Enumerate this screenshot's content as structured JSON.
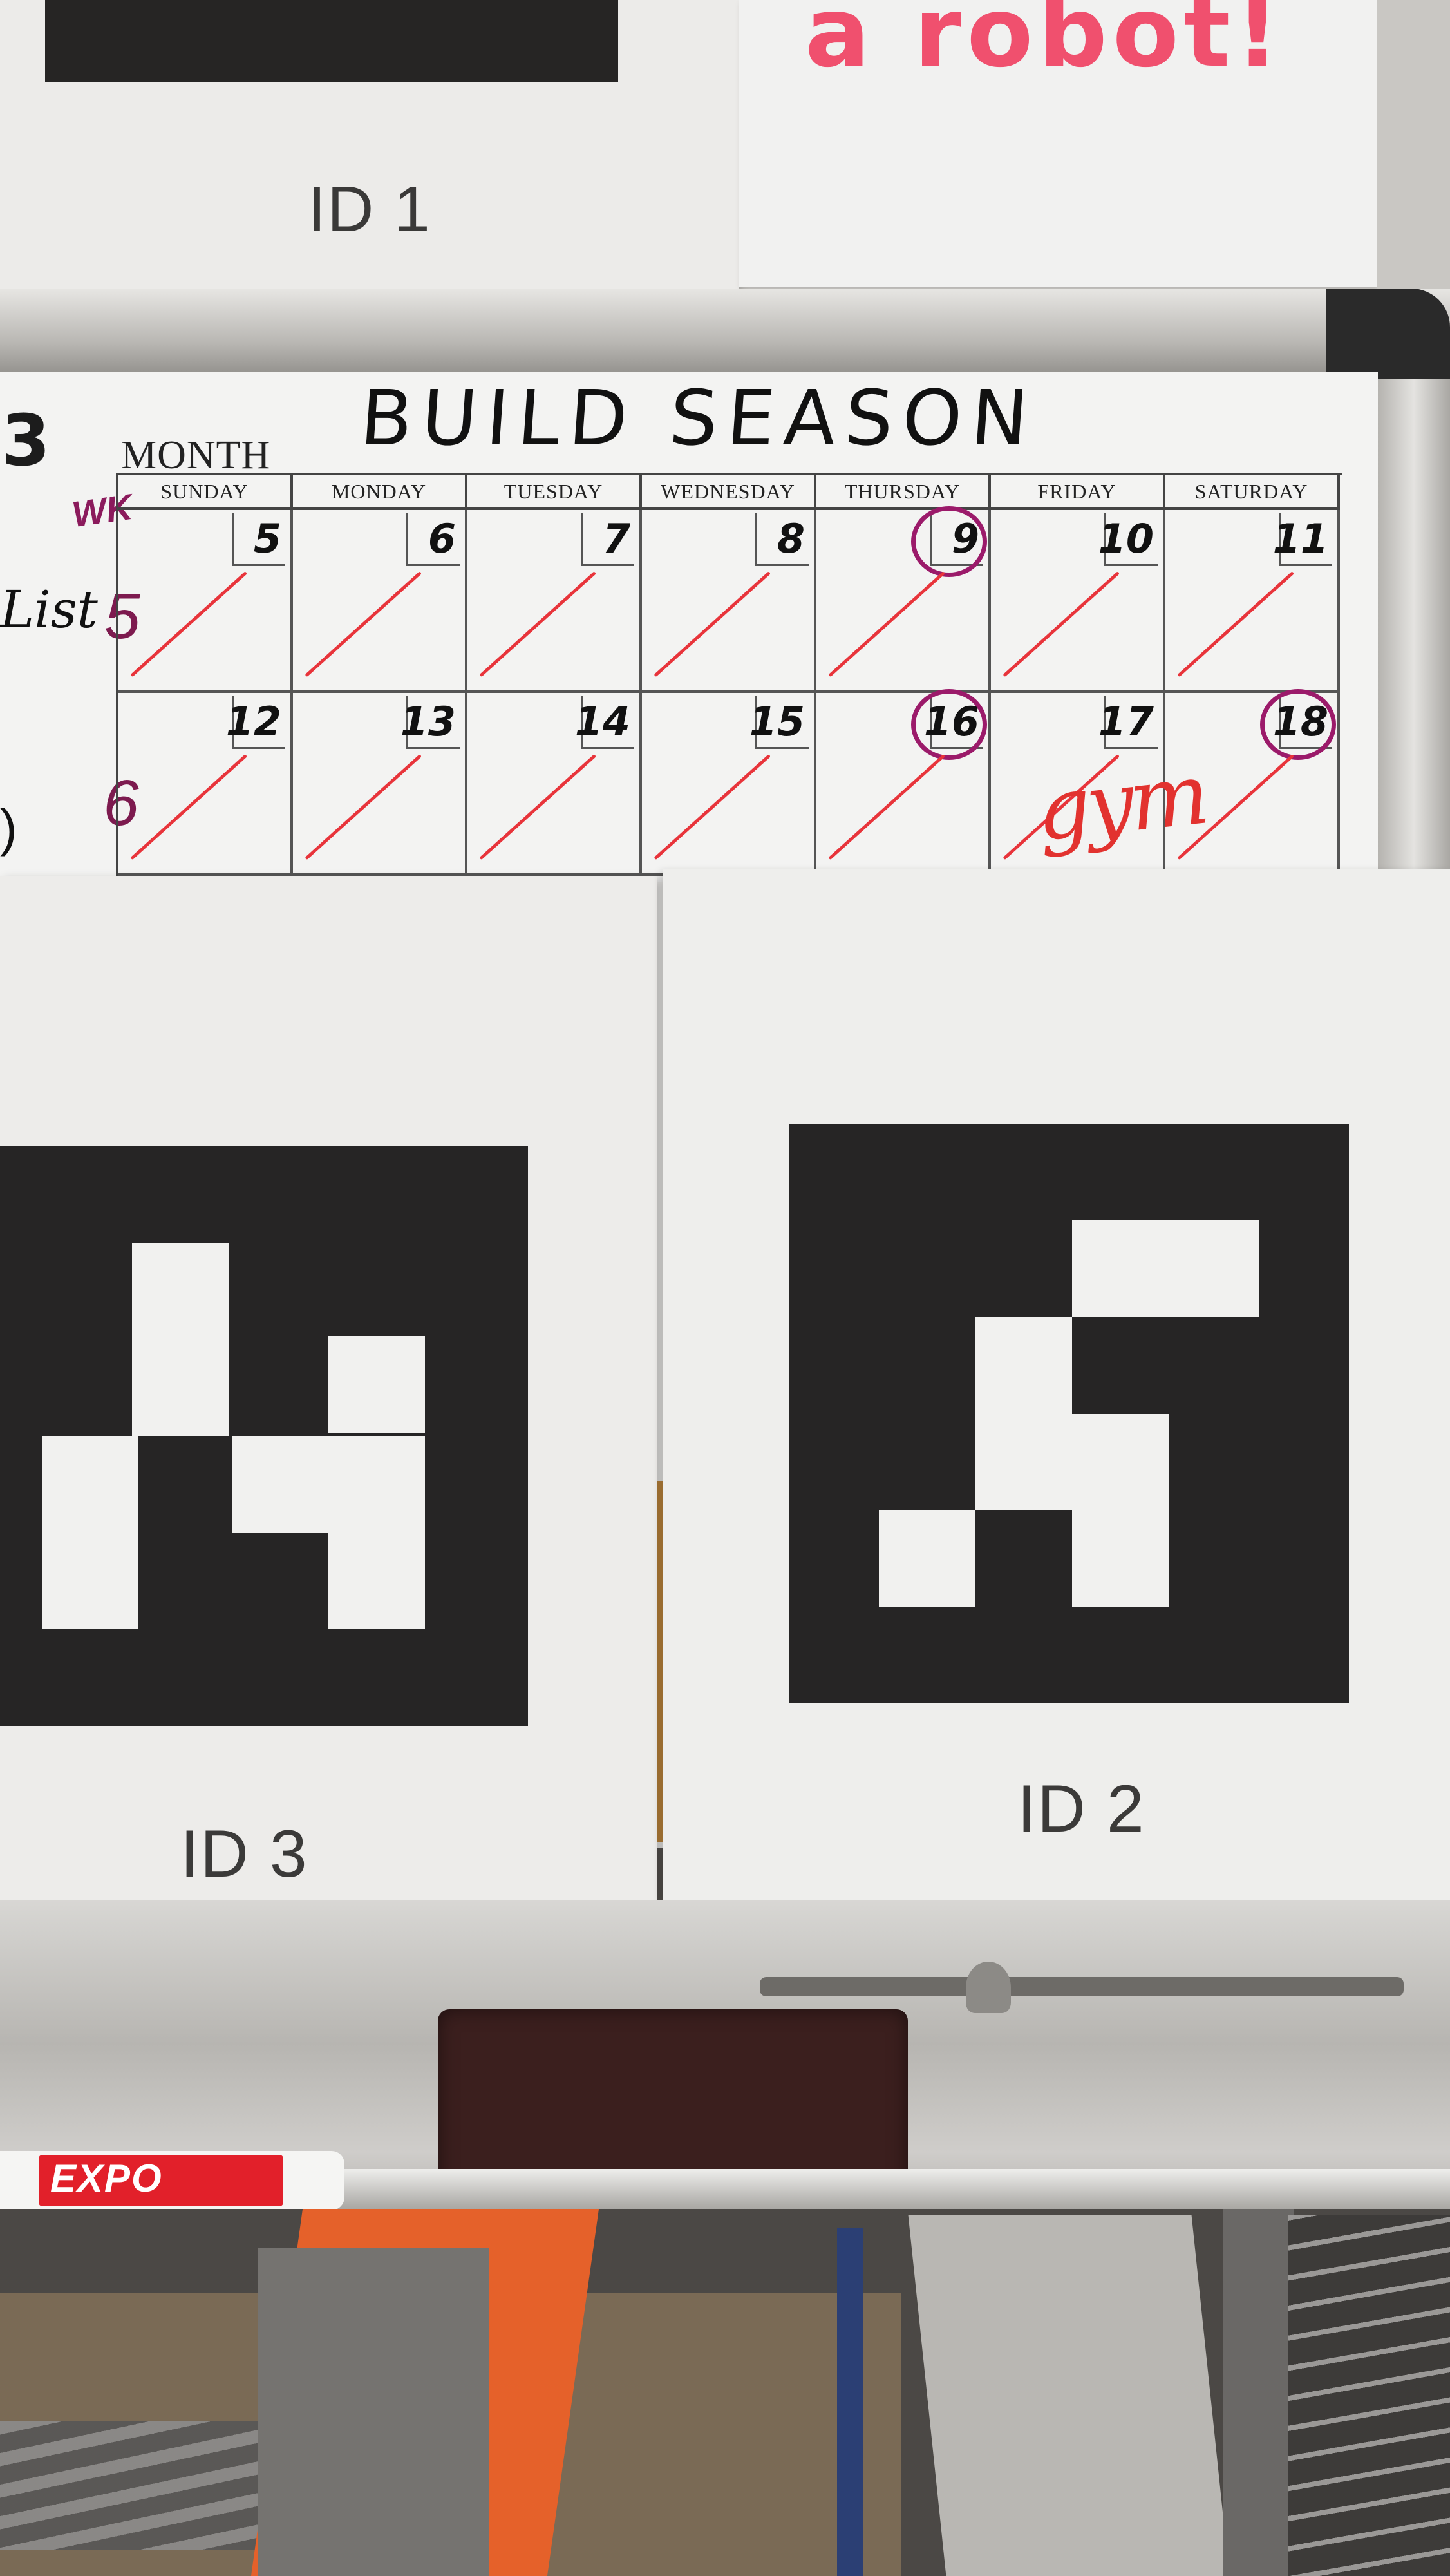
{
  "top_paper_left": {
    "id_label": "ID 1"
  },
  "top_paper_right": {
    "text": "a robot!"
  },
  "whiteboard": {
    "year_fragment": "3",
    "title": "BUILD SEASON",
    "month_label": "MONTH",
    "wk_label": "WK",
    "list_label": "List",
    "days": [
      "SUNDAY",
      "MONDAY",
      "TUESDAY",
      "WEDNESDAY",
      "THURSDAY",
      "FRIDAY",
      "SATURDAY"
    ],
    "weeks": [
      {
        "week_number": "5",
        "dates": [
          "5",
          "6",
          "7",
          "8",
          "9",
          "10",
          "11"
        ],
        "circled": [
          "9"
        ]
      },
      {
        "week_number": "6",
        "dates": [
          "12",
          "13",
          "14",
          "15",
          "16",
          "17",
          "18"
        ],
        "circled": [
          "16",
          "18"
        ]
      }
    ],
    "friday_note": "gym"
  },
  "bottom_papers": [
    {
      "id_label": "ID 3"
    },
    {
      "id_label": "ID 2"
    }
  ],
  "marker": {
    "brand": "EXPO"
  },
  "colors": {
    "ink_red": "#e8343b",
    "ink_purple": "#9b1a6a",
    "robot_pink": "#f0506e",
    "tag_black": "#262525"
  }
}
